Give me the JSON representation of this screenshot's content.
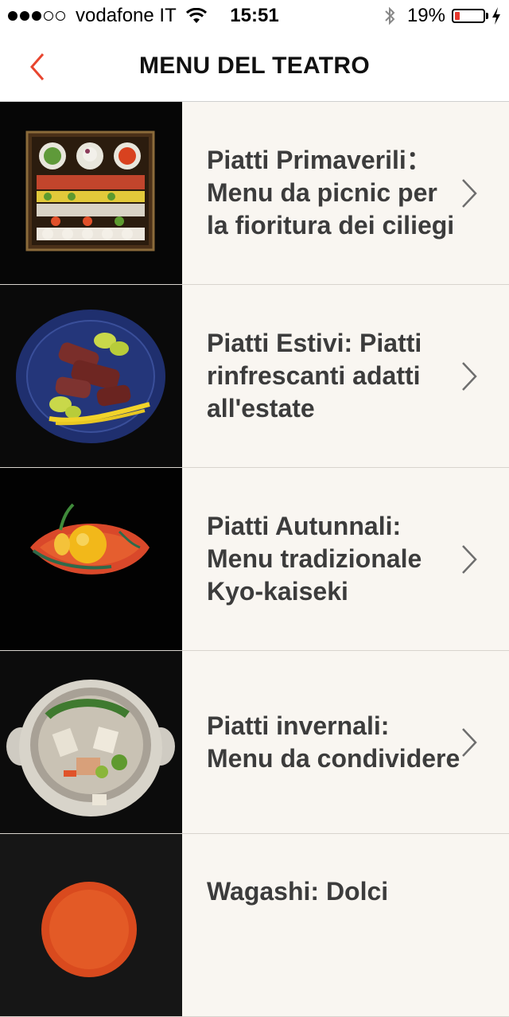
{
  "status_bar": {
    "carrier": "vodafone IT",
    "time": "15:51",
    "battery_percent": "19%",
    "battery_level": 0.19,
    "signal_bars": 3,
    "signal_total": 5,
    "icons": [
      "signal-icon",
      "wifi-icon",
      "bluetooth-icon",
      "battery-icon",
      "charging-icon"
    ]
  },
  "nav": {
    "title": "MENU DEL TEATRO",
    "back_icon": "chevron-left-icon"
  },
  "colors": {
    "accent": "#e8452f",
    "row_background": "#f9f6f1",
    "text": "#3c3c3c"
  },
  "menu_items": [
    {
      "label": "Piatti Primaverili：Menu da picnic per la fioritura dei ciliegi",
      "image": "bento-box-image"
    },
    {
      "label": "Piatti Estivi:  Piatti rinfrescanti adatti all'estate",
      "image": "blue-plate-duck-image"
    },
    {
      "label": "Piatti Autunnali: Menu tradizionale Kyo-kaiseki",
      "image": "leaf-dish-image"
    },
    {
      "label": "Piatti invernali: Menu da condividere",
      "image": "hot-pot-image"
    },
    {
      "label": "Wagashi: Dolci",
      "image": "red-plate-image"
    }
  ]
}
